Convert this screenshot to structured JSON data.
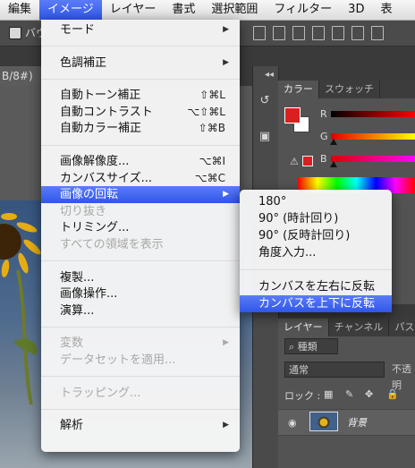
{
  "menubar": [
    "編集",
    "イメージ",
    "レイヤー",
    "書式",
    "選択範囲",
    "フィルター",
    "3D",
    "表"
  ],
  "menubar_active_index": 1,
  "background": {
    "options_label": "バウ",
    "doc_tab": "B/8#)",
    "panel_tabs_top": [
      "カラー",
      "スウォッチ"
    ],
    "channels": [
      "R",
      "G",
      "B"
    ],
    "layer_tabs": [
      "レイヤー",
      "チャンネル",
      "パス"
    ],
    "filter_kind": "種類",
    "blend_mode": "通常",
    "opacity_label": "不透明",
    "lock_label": "ロック :",
    "layer_name": "背景"
  },
  "image_menu": {
    "groups": [
      [
        {
          "label": "モード",
          "submenu": true
        }
      ],
      [
        {
          "label": "色調補正",
          "submenu": true
        }
      ],
      [
        {
          "label": "自動トーン補正",
          "shortcut": "⇧⌘L"
        },
        {
          "label": "自動コントラスト",
          "shortcut": "⌥⇧⌘L"
        },
        {
          "label": "自動カラー補正",
          "shortcut": "⇧⌘B"
        }
      ],
      [
        {
          "label": "画像解像度...",
          "shortcut": "⌥⌘I"
        },
        {
          "label": "カンバスサイズ...",
          "shortcut": "⌥⌘C"
        },
        {
          "label": "画像の回転",
          "submenu": true,
          "highlighted": true
        },
        {
          "label": "切り抜き",
          "disabled": true
        },
        {
          "label": "トリミング..."
        },
        {
          "label": "すべての領域を表示",
          "disabled": true
        }
      ],
      [
        {
          "label": "複製..."
        },
        {
          "label": "画像操作..."
        },
        {
          "label": "演算..."
        }
      ],
      [
        {
          "label": "変数",
          "submenu": true,
          "disabled": true
        },
        {
          "label": "データセットを適用...",
          "disabled": true
        }
      ],
      [
        {
          "label": "トラッピング...",
          "disabled": true
        }
      ],
      [
        {
          "label": "解析",
          "submenu": true
        }
      ]
    ]
  },
  "rotate_menu": {
    "groups": [
      [
        {
          "label": "180°"
        },
        {
          "label": "90° (時計回り)"
        },
        {
          "label": "90° (反時計回り)"
        },
        {
          "label": "角度入力..."
        }
      ],
      [
        {
          "label": "カンバスを左右に反転"
        },
        {
          "label": "カンバスを上下に反転",
          "highlighted": true
        }
      ]
    ]
  },
  "colors": {
    "menu_highlight": "#3a5ff0",
    "foreground_swatch": "#d9201f"
  }
}
